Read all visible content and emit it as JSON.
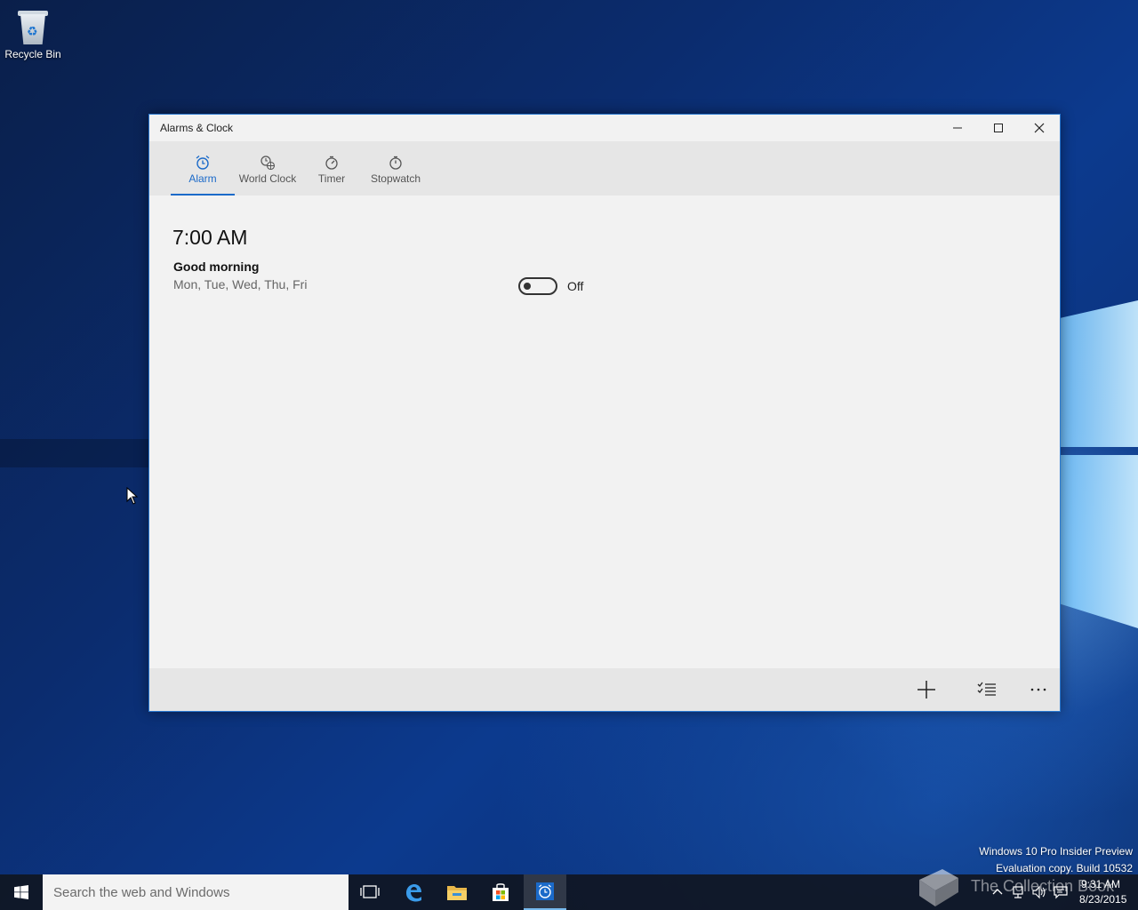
{
  "desktop": {
    "icons": [
      {
        "label": "Recycle Bin",
        "icon": "recycle-bin-icon"
      }
    ],
    "watermark": {
      "line1": "Windows 10 Pro Insider Preview",
      "line2": "Evaluation copy. Build 10532"
    },
    "logo_text": "The Collection Book"
  },
  "window": {
    "title": "Alarms & Clock",
    "controls": {
      "minimize": "minimize-icon",
      "maximize": "maximize-icon",
      "close": "close-icon"
    },
    "tabs": [
      {
        "label": "Alarm",
        "icon": "alarm-clock-icon",
        "active": true
      },
      {
        "label": "World Clock",
        "icon": "world-clock-icon",
        "active": false
      },
      {
        "label": "Timer",
        "icon": "timer-icon",
        "active": false
      },
      {
        "label": "Stopwatch",
        "icon": "stopwatch-icon",
        "active": false
      }
    ],
    "alarms": [
      {
        "time": "7:00 AM",
        "name": "Good morning",
        "days": "Mon, Tue, Wed, Thu, Fri",
        "toggle_state": "Off",
        "enabled": false
      }
    ],
    "commands": [
      {
        "name": "add-alarm",
        "icon": "plus-icon"
      },
      {
        "name": "select-alarms",
        "icon": "checklist-icon"
      },
      {
        "name": "more",
        "icon": "ellipsis-icon"
      }
    ]
  },
  "taskbar": {
    "search_placeholder": "Search the web and Windows",
    "pinned": [
      "task-view-icon",
      "edge-icon",
      "file-explorer-icon",
      "store-icon",
      "alarms-clock-icon"
    ],
    "clock": {
      "time": "9:31 AM",
      "date": "8/23/2015"
    }
  },
  "colors": {
    "accent": "#1b6ac9",
    "window_border": "#2b79d0",
    "taskbar": "#10161f"
  }
}
